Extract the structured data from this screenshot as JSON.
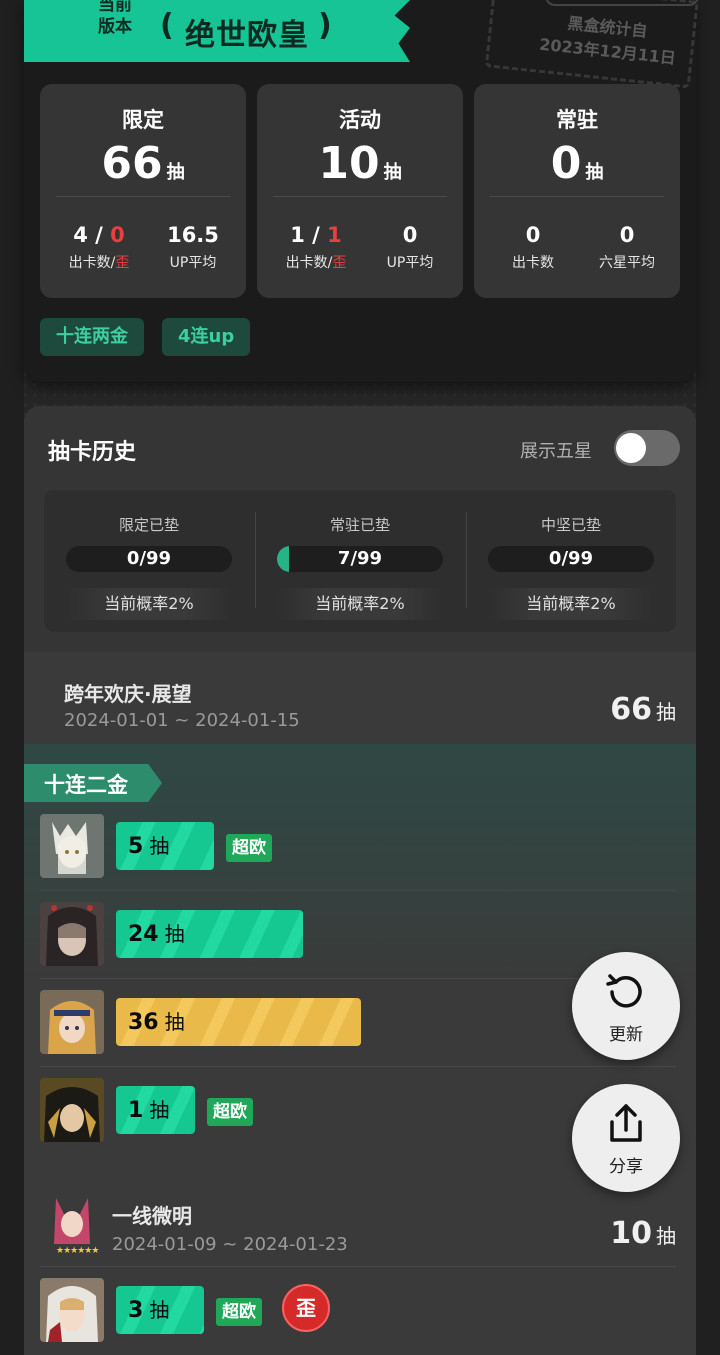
{
  "banner": {
    "subtitle_line1": "当前",
    "subtitle_line2": "版本",
    "title": "绝世欧皇"
  },
  "stamp": {
    "line1": "黑盒统计自",
    "line2": "2023年12月11日"
  },
  "summary": [
    {
      "title": "限定",
      "count": "66",
      "unit": "抽",
      "left": {
        "value_main": "4",
        "sep": " / ",
        "value_red": "0",
        "label_main": "出卡数",
        "label_sep": "/",
        "label_red": "歪"
      },
      "right": {
        "value": "16.5",
        "label": "UP平均"
      }
    },
    {
      "title": "活动",
      "count": "10",
      "unit": "抽",
      "left": {
        "value_main": "1",
        "sep": " / ",
        "value_red": "1",
        "label_main": "出卡数",
        "label_sep": "/",
        "label_red": "歪"
      },
      "right": {
        "value": "0",
        "label": "UP平均"
      }
    },
    {
      "title": "常驻",
      "count": "0",
      "unit": "抽",
      "left": {
        "value_main": "0",
        "label_main": "出卡数"
      },
      "right": {
        "value": "0",
        "label": "六星平均"
      }
    }
  ],
  "tags": [
    "十连两金",
    "4连up"
  ],
  "history": {
    "title": "抽卡历史",
    "toggle_label": "展示五星",
    "toggle_on": false,
    "pity": [
      {
        "label": "限定已垫",
        "value": "0/99",
        "progress": 0,
        "rate": "当前概率2%"
      },
      {
        "label": "常驻已垫",
        "value": "7/99",
        "progress": 0.0707,
        "rate": "当前概率2%"
      },
      {
        "label": "中坚已垫",
        "value": "0/99",
        "progress": 0,
        "rate": "当前概率2%"
      }
    ]
  },
  "pools": [
    {
      "name": "跨年欢庆·展望",
      "date": "2024-01-01 ~ 2024-01-15",
      "count": "66",
      "unit": "抽"
    },
    {
      "name": "一线微明",
      "date": "2024-01-09 ~ 2024-01-23",
      "count": "10",
      "unit": "抽",
      "stars": "★★★★★★"
    }
  ],
  "ribbon": "十连二金",
  "pulls": [
    {
      "count": "5",
      "unit": "抽",
      "badge": "超欧",
      "color": "green"
    },
    {
      "count": "24",
      "unit": "抽",
      "color": "green"
    },
    {
      "count": "36",
      "unit": "抽",
      "color": "gold"
    },
    {
      "count": "1",
      "unit": "抽",
      "badge": "超欧",
      "color": "green"
    },
    {
      "count": "3",
      "unit": "抽",
      "badge": "超欧",
      "wai": "歪",
      "color": "green"
    }
  ],
  "fab": {
    "refresh": "更新",
    "share": "分享"
  },
  "colors": {
    "accent": "#17c495",
    "red": "#e8403f",
    "gold": "#e9ba4a",
    "badge": "#1fa85a"
  }
}
